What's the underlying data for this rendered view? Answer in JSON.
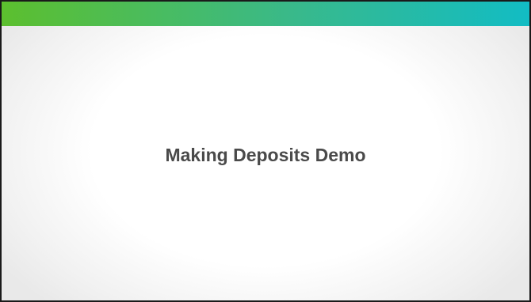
{
  "slide": {
    "title": "Making Deposits Demo"
  },
  "colors": {
    "bar_start": "#5cbf2e",
    "bar_mid": "#39b98a",
    "bar_end": "#12bcc4",
    "title_text": "#4a4a4a",
    "border": "#1a1a1a"
  }
}
